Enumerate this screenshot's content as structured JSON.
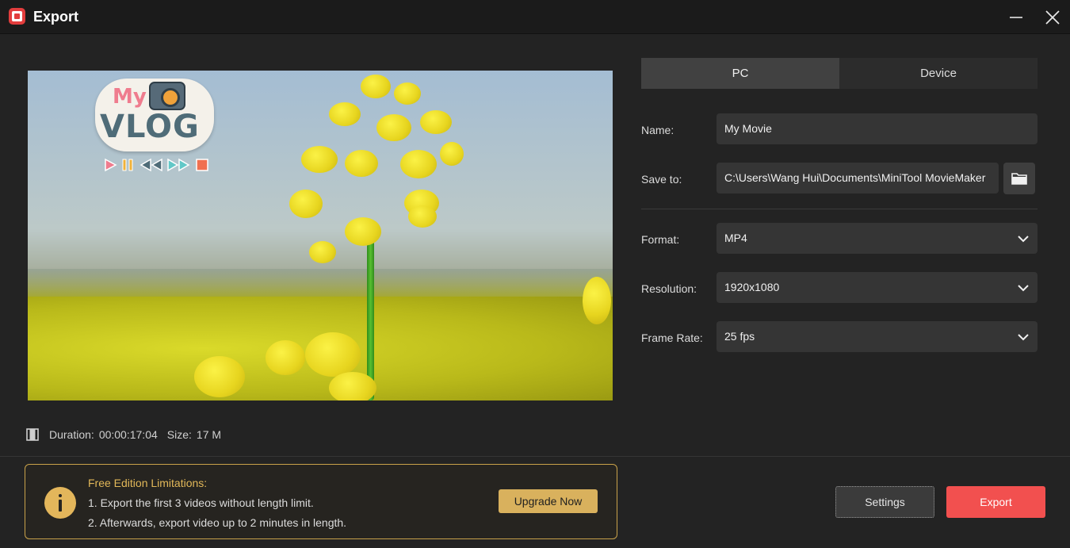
{
  "window": {
    "title": "Export"
  },
  "preview": {
    "badge_top": "My",
    "badge_main": "VLOG"
  },
  "stats": {
    "duration_label": "Duration:",
    "duration_value": "00:00:17:04",
    "size_label": "Size:",
    "size_value": "17 M"
  },
  "notice": {
    "title": "Free Edition Limitations:",
    "line1": "1. Export the first 3 videos without length limit.",
    "line2": "2. Afterwards, export video up to 2 minutes in length.",
    "upgrade_label": "Upgrade Now"
  },
  "tabs": [
    {
      "label": "PC",
      "active": true
    },
    {
      "label": "Device",
      "active": false
    }
  ],
  "form": {
    "name_label": "Name:",
    "name_value": "My Movie",
    "save_to_label": "Save to:",
    "save_to_value": "C:\\Users\\Wang Hui\\Documents\\MiniTool MovieMaker",
    "format_label": "Format:",
    "format_value": "MP4",
    "resolution_label": "Resolution:",
    "resolution_value": "1920x1080",
    "frame_rate_label": "Frame Rate:",
    "frame_rate_value": "25 fps"
  },
  "footer": {
    "settings_label": "Settings",
    "export_label": "Export"
  },
  "colors": {
    "accent_export": "#f2504f",
    "notice_border": "#c9a24a",
    "upgrade_button": "#d9b15d"
  },
  "icons": {
    "app": "app-logo-icon",
    "minimize": "minimize-icon",
    "close": "close-icon",
    "film": "film-icon",
    "info": "info-icon",
    "folder": "folder-icon",
    "dropdown": "chevron-down-icon"
  }
}
